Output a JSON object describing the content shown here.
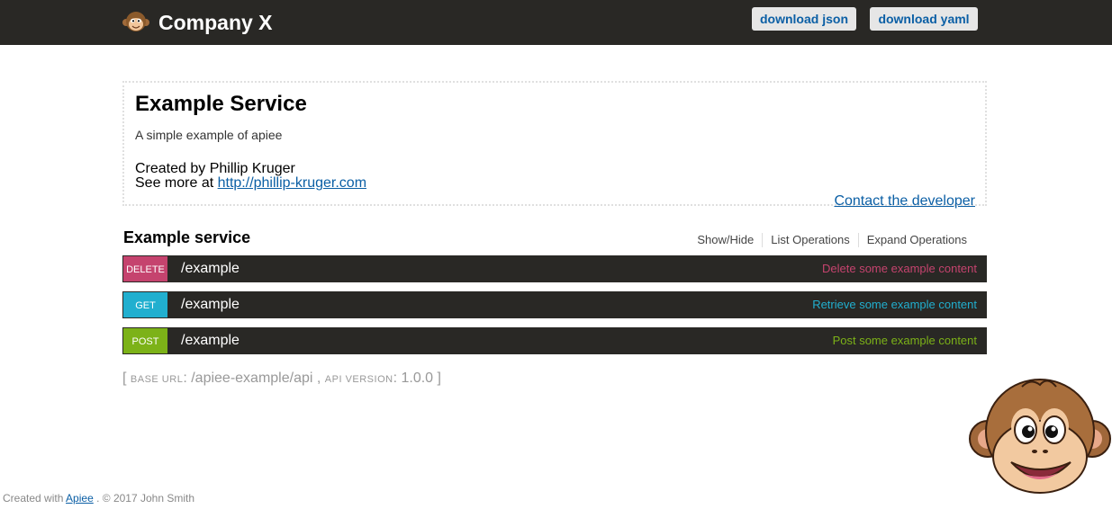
{
  "header": {
    "title": "Company X",
    "download_json": "download json",
    "download_yaml": "download yaml"
  },
  "info": {
    "title": "Example Service",
    "description": "A simple example of apiee",
    "created_by": "Created by Phillip Kruger",
    "see_more_prefix": "See more at",
    "see_more_link": "http://phillip-kruger.com",
    "contact": "Contact the developer"
  },
  "resource": {
    "name": "Example service",
    "links": [
      "Show/Hide",
      "List Operations",
      "Expand Operations"
    ],
    "operations": [
      {
        "method": "DELETE",
        "path": "/example",
        "summary": "Delete some example content",
        "color": "#c5436e"
      },
      {
        "method": "GET",
        "path": "/example",
        "summary": "Retrieve some example content",
        "color": "#21afcf"
      },
      {
        "method": "POST",
        "path": "/example",
        "summary": "Post some example content",
        "color": "#7cb218"
      }
    ]
  },
  "base": {
    "open": "[",
    "base_url_label": "base url",
    "base_url": "/apiee-example/api",
    "sep": ",",
    "api_version_label": "api version",
    "api_version": "1.0.0",
    "close": "]"
  },
  "footer": {
    "prefix": "Created with",
    "link": "Apiee",
    "suffix": ". © 2017 John Smith"
  },
  "icons": {
    "logo": "monkey-logo-icon",
    "mascot": "monkey-mascot-icon"
  }
}
